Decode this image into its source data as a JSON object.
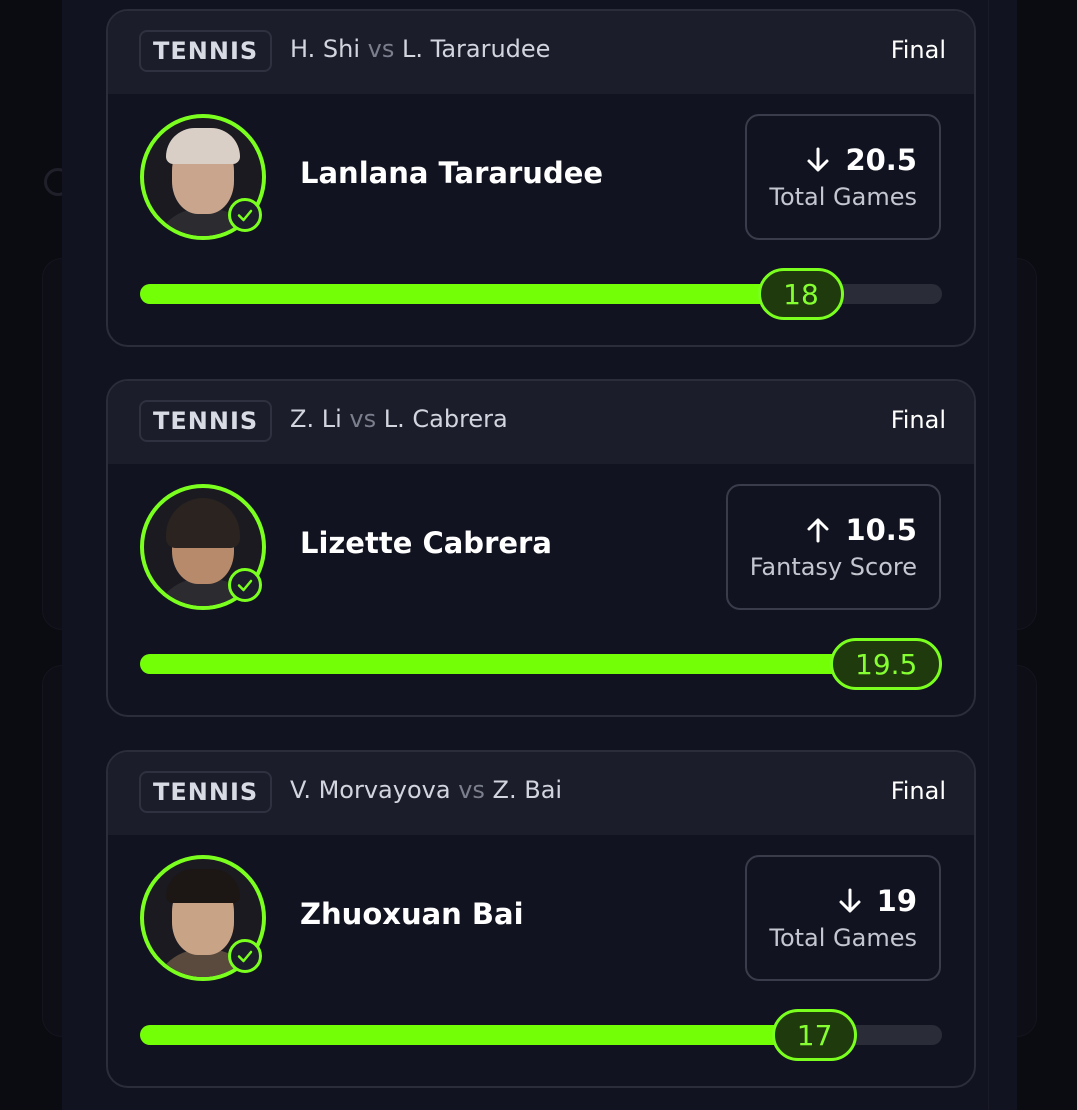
{
  "colors": {
    "accent": "#7aff1e",
    "card_bg": "#111320",
    "header_bg": "#1b1d2a"
  },
  "cards": [
    {
      "sport": "TENNIS",
      "player_a": "H. Shi",
      "vs": "vs",
      "player_b": "L. Tararudee",
      "status": "Final",
      "player_name": "Lanlana Tararudee",
      "direction_icon": "arrow-down-icon",
      "line_value": "20.5",
      "stat_type": "Total Games",
      "result": "18",
      "progress_fraction": 0.878
    },
    {
      "sport": "TENNIS",
      "player_a": "Z. Li",
      "vs": "vs",
      "player_b": "L. Cabrera",
      "status": "Final",
      "player_name": "Lizette Cabrera",
      "direction_icon": "arrow-up-icon",
      "line_value": "10.5",
      "stat_type": "Fantasy Score",
      "result": "19.5",
      "progress_fraction": 1.0
    },
    {
      "sport": "TENNIS",
      "player_a": "V. Morvayova",
      "vs": "vs",
      "player_b": "Z. Bai",
      "status": "Final",
      "player_name": "Zhuoxuan Bai",
      "direction_icon": "arrow-down-icon",
      "line_value": "19",
      "stat_type": "Total Games",
      "result": "17",
      "progress_fraction": 0.895
    }
  ]
}
